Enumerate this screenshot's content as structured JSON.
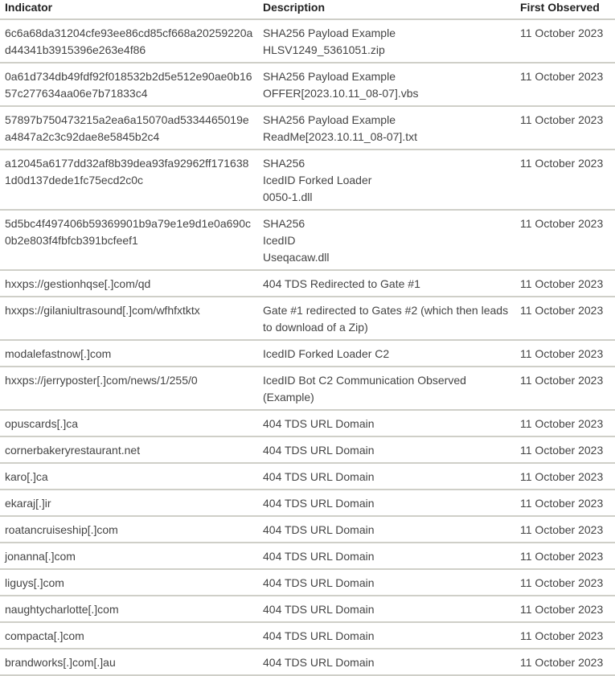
{
  "table": {
    "headers": {
      "indicator": "Indicator",
      "description": "Description",
      "first_observed": "First Observed"
    },
    "rows": [
      {
        "indicator": "6c6a68da31204cfe93ee86cd85cf668a20259220ad44341b3915396e263e4f86",
        "description": [
          "SHA256 Payload Example",
          "HLSV1249_5361051.zip"
        ],
        "first_observed": "11 October 2023"
      },
      {
        "indicator": "0a61d734db49fdf92f018532b2d5e512e90ae0b1657c277634aa06e7b71833c4",
        "description": [
          "SHA256 Payload Example",
          "OFFER[2023.10.11_08-07].vbs"
        ],
        "first_observed": "11 October 2023"
      },
      {
        "indicator": "57897b750473215a2ea6a15070ad5334465019ea4847a2c3c92dae8e5845b2c4",
        "description": [
          "SHA256 Payload Example",
          "ReadMe[2023.10.11_08-07].txt"
        ],
        "first_observed": "11 October 2023"
      },
      {
        "indicator": "a12045a6177dd32af8b39dea93fa92962ff1716381d0d137dede1fc75ecd2c0c",
        "description": [
          "SHA256",
          "IcedID Forked Loader",
          "0050-1.dll"
        ],
        "first_observed": "11 October 2023"
      },
      {
        "indicator": "5d5bc4f497406b59369901b9a79e1e9d1e0a690c0b2e803f4fbfcb391bcfeef1",
        "description": [
          "SHA256",
          "IcedID",
          "Useqacaw.dll"
        ],
        "first_observed": "11 October 2023"
      },
      {
        "indicator": "hxxps://gestionhqse[.]com/qd",
        "description": [
          "404 TDS Redirected to Gate #1"
        ],
        "first_observed": "11 October 2023"
      },
      {
        "indicator": "hxxps://gilaniultrasound[.]com/wfhfxtktx",
        "description": [
          "Gate #1 redirected to Gates #2 (which then leads to download of a Zip)"
        ],
        "first_observed": "11 October 2023"
      },
      {
        "indicator": "modalefastnow[.]com",
        "description": [
          "IcedID Forked Loader C2"
        ],
        "first_observed": "11 October 2023"
      },
      {
        "indicator": "hxxps://jerryposter[.]com/news/1/255/0",
        "description": [
          "IcedID Bot C2 Communication Observed (Example)"
        ],
        "first_observed": "11 October 2023"
      },
      {
        "indicator": "opuscards[.]ca",
        "description": [
          "404 TDS URL Domain"
        ],
        "first_observed": "11 October 2023"
      },
      {
        "indicator": "cornerbakeryrestaurant.net",
        "description": [
          "404 TDS URL Domain"
        ],
        "first_observed": "11 October 2023"
      },
      {
        "indicator": "karo[.]ca",
        "description": [
          "404 TDS URL Domain"
        ],
        "first_observed": "11 October 2023"
      },
      {
        "indicator": "ekaraj[.]ir",
        "description": [
          "404 TDS URL Domain"
        ],
        "first_observed": "11 October 2023"
      },
      {
        "indicator": "roatancruiseship[.]com",
        "description": [
          "404 TDS URL Domain"
        ],
        "first_observed": "11 October 2023"
      },
      {
        "indicator": "jonanna[.]com",
        "description": [
          "404 TDS URL Domain"
        ],
        "first_observed": "11 October 2023"
      },
      {
        "indicator": "liguys[.]com",
        "description": [
          "404 TDS URL Domain"
        ],
        "first_observed": "11 October 2023"
      },
      {
        "indicator": "naughtycharlotte[.]com",
        "description": [
          "404 TDS URL Domain"
        ],
        "first_observed": "11 October 2023"
      },
      {
        "indicator": "compacta[.]com",
        "description": [
          "404 TDS URL Domain"
        ],
        "first_observed": "11 October 2023"
      },
      {
        "indicator": "brandworks[.]com[.]au",
        "description": [
          "404 TDS URL Domain"
        ],
        "first_observed": "11 October 2023"
      }
    ]
  }
}
